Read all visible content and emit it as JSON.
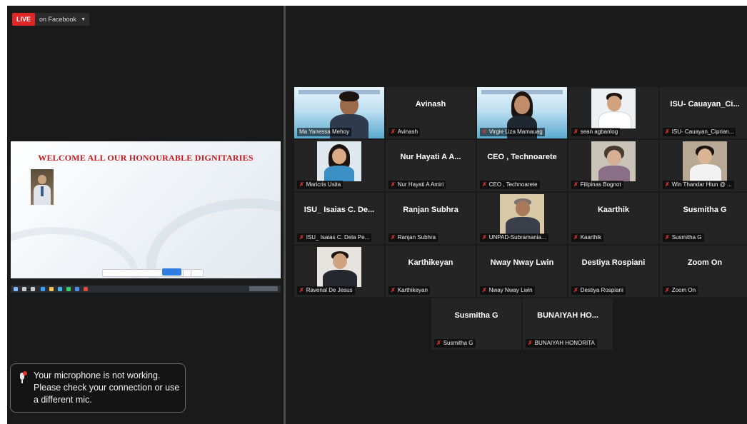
{
  "live": {
    "tag": "LIVE",
    "platform": "on Facebook"
  },
  "shared_screen": {
    "slide_title": "WELCOME ALL OUR HONOURABLE DIGNITARIES"
  },
  "participants_row1": [
    {
      "display": "",
      "label": "Ma Yanessa Mehoy",
      "video": true,
      "active": true
    },
    {
      "display": "Avinash",
      "label": "Avinash",
      "video": false
    },
    {
      "display": "",
      "label": "Virgie Liza Mamauag",
      "video": true
    },
    {
      "display": "",
      "label": "sean agbanlog",
      "video": true
    },
    {
      "display": "ISU- Cauayan_Ci...",
      "label": "ISU- Cauayan_Ciprian...",
      "video": false
    }
  ],
  "participants_row2": [
    {
      "display": "",
      "label": "Maricris Usita",
      "video": true
    },
    {
      "display": "Nur Hayati A A...",
      "label": "Nur Hayati A Amiri",
      "video": false
    },
    {
      "display": "CEO , Technoarete",
      "label": "CEO , Technoarete",
      "video": false
    },
    {
      "display": "",
      "label": "Filipinas Bognot",
      "video": true
    },
    {
      "display": "",
      "label": "Win Thandar Htun @ ...",
      "video": true
    }
  ],
  "participants_row3": [
    {
      "display": "ISU_ Isaias C. De...",
      "label": "ISU_ Isaias C. Dela Pe...",
      "video": false
    },
    {
      "display": "Ranjan Subhra",
      "label": "Ranjan Subhra",
      "video": false
    },
    {
      "display": "",
      "label": "UNPAD-Subramania...",
      "video": true
    },
    {
      "display": "Kaarthik",
      "label": "Kaarthik",
      "video": false
    },
    {
      "display": "Susmitha G",
      "label": "Susmitha G",
      "video": false
    }
  ],
  "participants_row4": [
    {
      "display": "",
      "label": "Ravenal De Jesus",
      "video": true
    },
    {
      "display": "Karthikeyan",
      "label": "Karthikeyan",
      "video": false
    },
    {
      "display": "Nway Nway Lwin",
      "label": "Nway Nway Lwin",
      "video": false
    },
    {
      "display": "Destiya Rospiani",
      "label": "Destiya Rospiani",
      "video": false
    },
    {
      "display": "Zoom On",
      "label": "Zoom On",
      "video": false
    }
  ],
  "participants_row5": [
    {
      "display": "Susmitha G",
      "label": "Susmitha G",
      "video": false
    },
    {
      "display": "BUNAIYAH HO...",
      "label": "BUNAIYAH HONORITA",
      "video": false
    }
  ],
  "toast": {
    "message": "Your microphone is not working. Please check your connection or use a different mic.",
    "icon": "microphone-warning-icon"
  },
  "colors": {
    "background": "#1a1a1a",
    "tile": "#242424",
    "active_border": "#b2d43b",
    "live_red": "#e02727",
    "mic_off_red": "#e0332e",
    "slide_title_red": "#c8161d"
  }
}
